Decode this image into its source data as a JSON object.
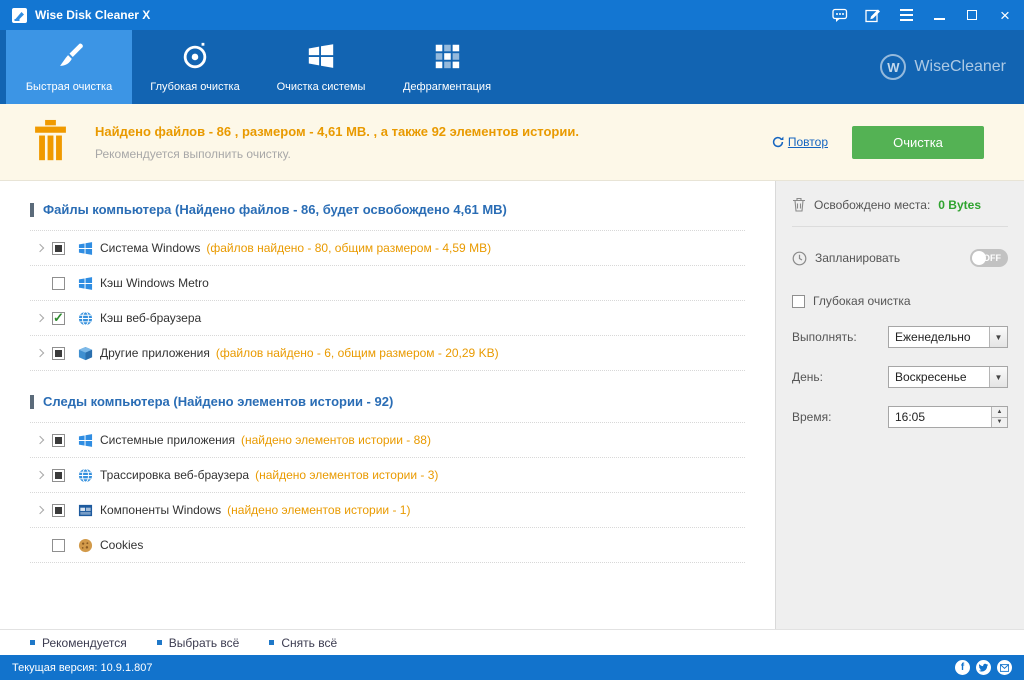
{
  "colors": {
    "titlebar_blue": "#1376d2",
    "navbar_blue": "#1264b2",
    "active_tab_blue": "#3c95e5",
    "summary_bg": "#fdf8e8",
    "warning_orange": "#e99a00",
    "clean_button_green": "#54b254",
    "freed_green": "#2fa32f",
    "section_blue": "#2a6db5"
  },
  "titlebar": {
    "title": "Wise Disk Cleaner X"
  },
  "nav": {
    "tabs": [
      {
        "label": "Быстрая очистка",
        "icon": "brush-icon",
        "active": true
      },
      {
        "label": "Глубокая очистка",
        "icon": "disc-icon",
        "active": false
      },
      {
        "label": "Очистка системы",
        "icon": "windows-flag-icon",
        "active": false
      },
      {
        "label": "Дефрагментация",
        "icon": "defrag-grid-icon",
        "active": false
      }
    ],
    "brand": "WiseCleaner",
    "brand_letter": "W"
  },
  "summary": {
    "headline": "Найдено файлов - 86 , размером - 4,61 MB. , а также 92 элементов истории.",
    "subtext": "Рекомендуется выполнить очистку.",
    "repeat_label": "Повтор",
    "clean_button": "Очистка"
  },
  "main": {
    "sections": [
      {
        "title": "Файлы компьютера  (Найдено файлов - 86, будет освобождено 4,61 MB)",
        "items": [
          {
            "label": "Система Windows",
            "detail": "(файлов найдено - 80, общим размером - 4,59 MB)",
            "check": "partial",
            "expandable": true,
            "icon": "windows-flag"
          },
          {
            "label": "Кэш Windows Metro",
            "detail": "",
            "check": "none",
            "expandable": false,
            "icon": "windows-flag"
          },
          {
            "label": "Кэш веб-браузера",
            "detail": "",
            "check": "checked",
            "expandable": true,
            "icon": "globe"
          },
          {
            "label": "Другие приложения",
            "detail": "(файлов найдено - 6, общим размером - 20,29 KB)",
            "check": "partial",
            "expandable": true,
            "icon": "package-box"
          }
        ]
      },
      {
        "title": "Следы компьютера  (Найдено элементов истории - 92)",
        "items": [
          {
            "label": "Системные приложения",
            "detail": "(найдено элементов истории - 88)",
            "check": "partial",
            "expandable": true,
            "icon": "windows-flag"
          },
          {
            "label": "Трассировка веб-браузера",
            "detail": "(найдено элементов истории - 3)",
            "check": "partial",
            "expandable": true,
            "icon": "globe"
          },
          {
            "label": "Компоненты Windows",
            "detail": "(найдено элементов истории - 1)",
            "check": "partial",
            "expandable": true,
            "icon": "window-component"
          },
          {
            "label": "Cookies",
            "detail": "",
            "check": "none",
            "expandable": false,
            "icon": "cookie"
          }
        ]
      }
    ]
  },
  "sidebar": {
    "freed_label": "Освобождено места:",
    "freed_value": "0 Bytes",
    "schedule_label": "Запланировать",
    "toggle_state": "OFF",
    "deep_clean_label": "Глубокая очистка",
    "fields": [
      {
        "label": "Выполнять:",
        "value": "Еженедельно",
        "type": "select"
      },
      {
        "label": "День:",
        "value": "Воскресенье",
        "type": "select"
      },
      {
        "label": "Время:",
        "value": "16:05",
        "type": "time"
      }
    ]
  },
  "footer": {
    "links": [
      {
        "label": "Рекомендуется"
      },
      {
        "label": "Выбрать всё"
      },
      {
        "label": "Снять всё"
      }
    ]
  },
  "statusbar": {
    "version": "Текущая версия: 10.9.1.807",
    "social_icons": [
      "facebook",
      "twitter",
      "email"
    ]
  }
}
